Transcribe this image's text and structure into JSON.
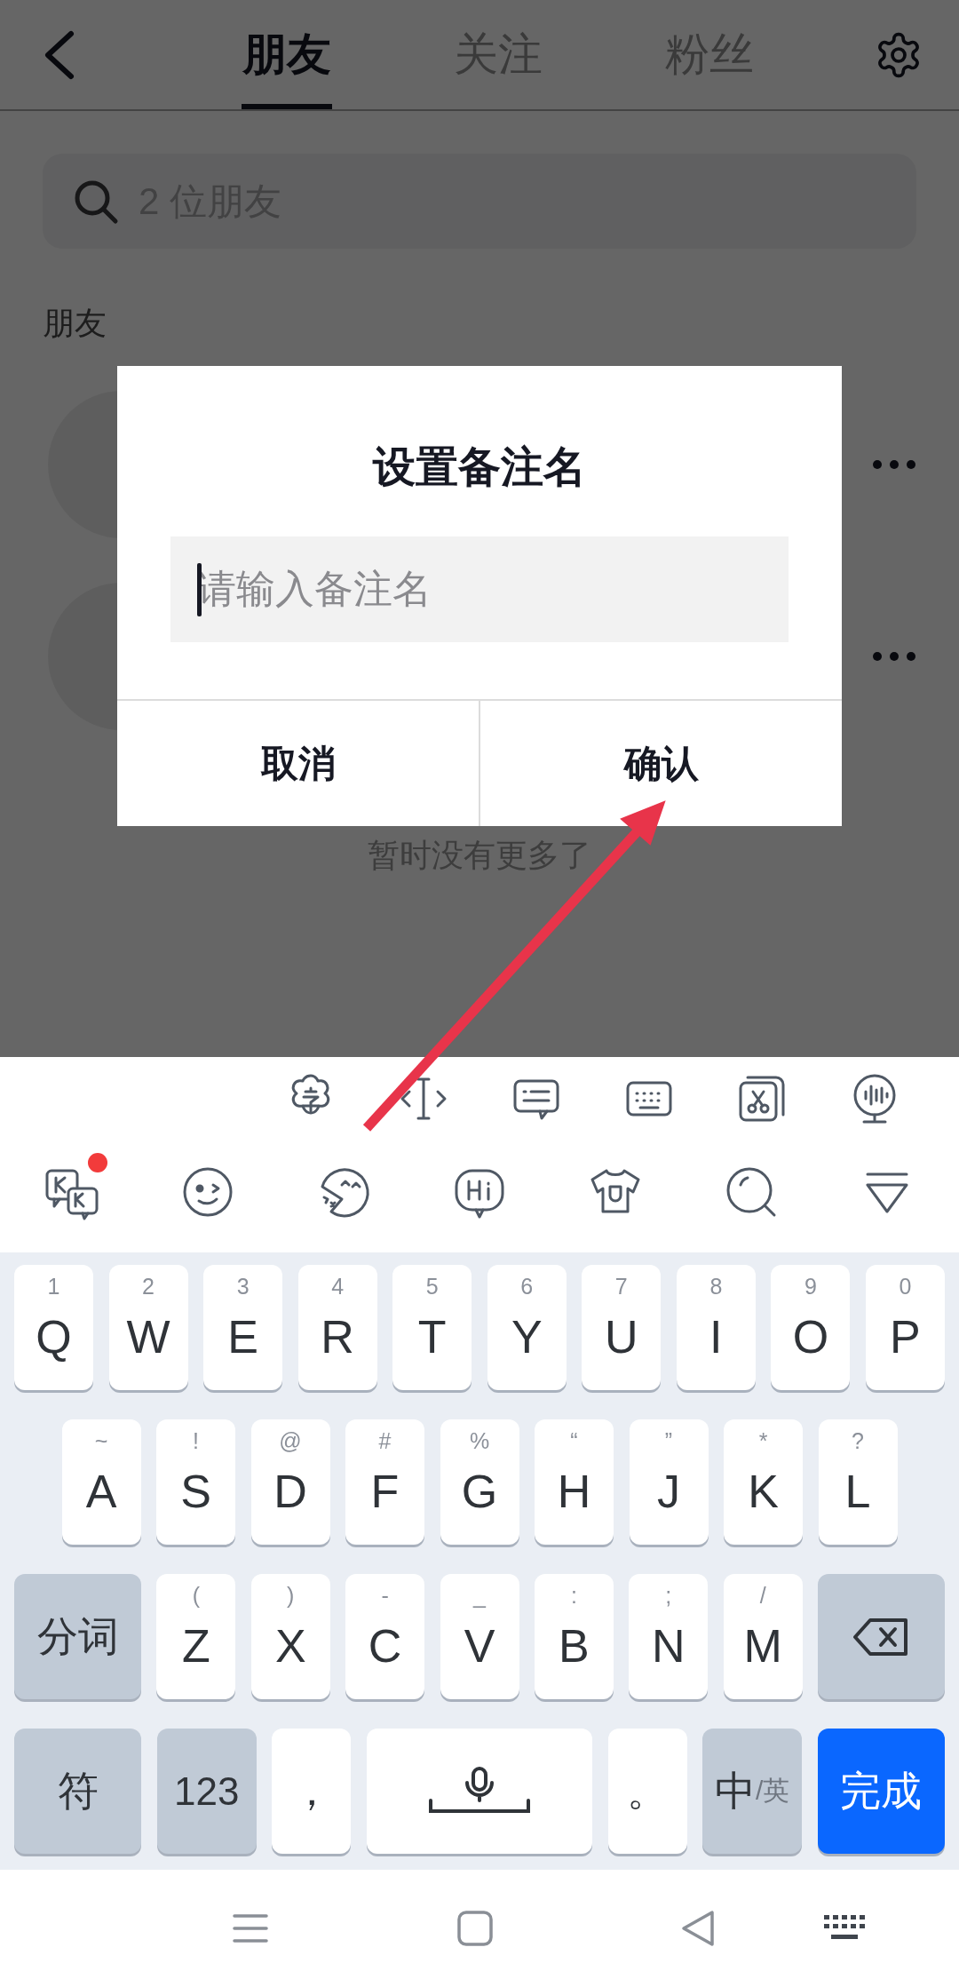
{
  "header": {
    "tabs": [
      {
        "label": "朋友",
        "selected": true
      },
      {
        "label": "关注",
        "selected": false
      },
      {
        "label": "粉丝",
        "selected": false
      }
    ]
  },
  "search": {
    "placeholder": "2 位朋友"
  },
  "section_title": "朋友",
  "friends": [
    {
      "kind": "contact"
    },
    {
      "kind": "contact"
    }
  ],
  "list_footer": "暂时没有更多了",
  "dialog": {
    "title": "设置备注名",
    "input": {
      "placeholder": "请输入备注名",
      "focused": true
    },
    "buttons": [
      "取消",
      "确认"
    ]
  },
  "keyboard": {
    "has_notification": true,
    "rows": [
      {
        "keys": [
          {
            "kind": "letter",
            "label": "Q",
            "hint": "1"
          },
          {
            "kind": "letter",
            "label": "W",
            "hint": "2"
          },
          {
            "kind": "letter",
            "label": "E",
            "hint": "3"
          },
          {
            "kind": "letter",
            "label": "R",
            "hint": "4"
          },
          {
            "kind": "letter",
            "label": "T",
            "hint": "5"
          },
          {
            "kind": "letter",
            "label": "Y",
            "hint": "6"
          },
          {
            "kind": "letter",
            "label": "U",
            "hint": "7"
          },
          {
            "kind": "letter",
            "label": "I",
            "hint": "8"
          },
          {
            "kind": "letter",
            "label": "O",
            "hint": "9"
          },
          {
            "kind": "letter",
            "label": "P",
            "hint": "0"
          }
        ]
      },
      {
        "keys": [
          {
            "kind": "letter",
            "label": "A",
            "hint": "~"
          },
          {
            "kind": "letter",
            "label": "S",
            "hint": "!"
          },
          {
            "kind": "letter",
            "label": "D",
            "hint": "@"
          },
          {
            "kind": "letter",
            "label": "F",
            "hint": "#"
          },
          {
            "kind": "letter",
            "label": "G",
            "hint": "%"
          },
          {
            "kind": "letter",
            "label": "H",
            "hint": "“"
          },
          {
            "kind": "letter",
            "label": "J",
            "hint": "”"
          },
          {
            "kind": "letter",
            "label": "K",
            "hint": "*"
          },
          {
            "kind": "letter",
            "label": "L",
            "hint": "?"
          }
        ]
      },
      {
        "keys": [
          {
            "kind": "function",
            "label": "分词"
          },
          {
            "kind": "letter",
            "label": "Z",
            "hint": "("
          },
          {
            "kind": "letter",
            "label": "X",
            "hint": ")"
          },
          {
            "kind": "letter",
            "label": "C",
            "hint": "-"
          },
          {
            "kind": "letter",
            "label": "V",
            "hint": "_"
          },
          {
            "kind": "letter",
            "label": "B",
            "hint": ":"
          },
          {
            "kind": "letter",
            "label": "N",
            "hint": ";"
          },
          {
            "kind": "letter",
            "label": "M",
            "hint": "/"
          },
          {
            "kind": "backspace"
          }
        ]
      },
      {
        "keys": [
          {
            "kind": "function",
            "label": "符"
          },
          {
            "kind": "number",
            "label": "123"
          },
          {
            "kind": "punct",
            "label": "，"
          },
          {
            "kind": "space"
          },
          {
            "kind": "punct",
            "label": "。"
          },
          {
            "kind": "language",
            "label": "中",
            "secondary": "/英"
          },
          {
            "kind": "action",
            "label": "完成"
          }
        ]
      }
    ]
  }
}
